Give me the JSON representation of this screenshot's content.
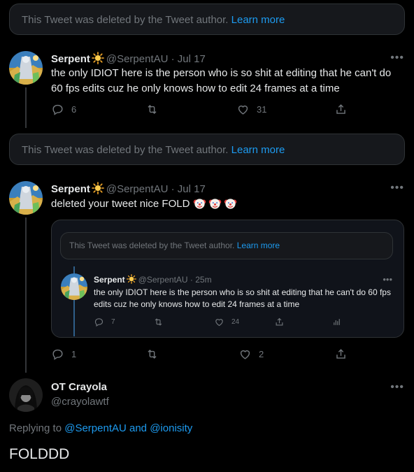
{
  "deleted_notice": {
    "text": "This Tweet was deleted by the Tweet author.",
    "link": "Learn more"
  },
  "tweet1": {
    "name": "Serpent",
    "handle_date": "@SerpentAU · Jul 17",
    "text": "the only IDIOT here is the person who is so shit at editing that he can't do 60 fps edits cuz he only knows how to edit 24 frames at a time",
    "replies": "6",
    "retweets": "",
    "likes": "31"
  },
  "tweet2": {
    "name": "Serpent",
    "handle_date": "@SerpentAU · Jul 17",
    "text": "deleted your tweet nice FOLD",
    "emoji": "🤡🤡🤡",
    "replies": "1",
    "retweets": "",
    "likes": "2"
  },
  "quote": {
    "deleted_text": "This Tweet was deleted by the Tweet author.",
    "deleted_link": "Learn more",
    "name": "Serpent",
    "handle_date": "@SerpentAU · 25m",
    "text": "the only IDIOT here is the person who is so shit at editing that he can't do 60 fps edits cuz he only knows how to edit 24 frames at a time",
    "replies": "7",
    "retweets": "",
    "likes": "24"
  },
  "main_tweet": {
    "name": "OT Crayola",
    "handle": "@crayolawtf",
    "replying_prefix": "Replying to",
    "reply_handle_1": "@SerpentAU",
    "reply_conj": "and",
    "reply_handle_2": "@ionisity",
    "text": "FOLDDD"
  },
  "colors": {
    "background": "#000000",
    "accent": "#1d9bf0",
    "muted": "#71767b",
    "border": "#2f3336"
  },
  "icons": [
    "reply-icon",
    "retweet-icon",
    "like-icon",
    "share-icon",
    "analytics-icon",
    "more-icon",
    "sun-emoji-icon",
    "clown-emoji-icon"
  ]
}
